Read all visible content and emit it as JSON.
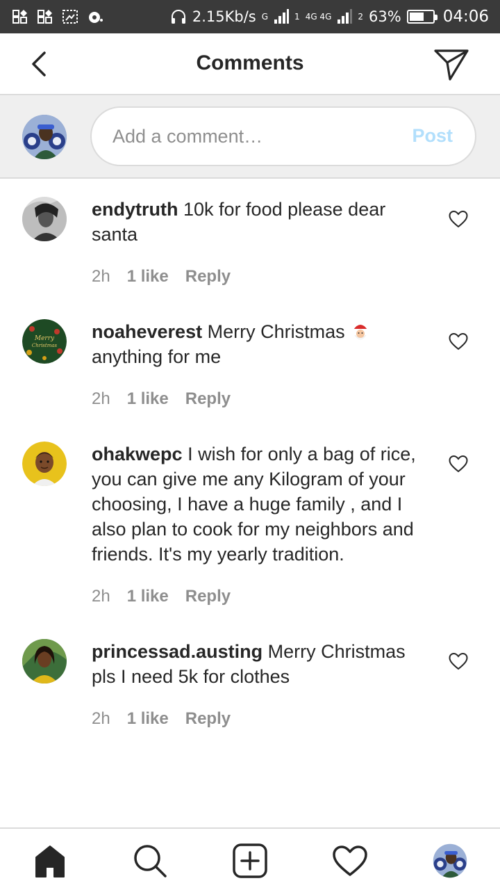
{
  "status_bar": {
    "network_speed": "2.15Kb/s",
    "sim1_label": "G",
    "sim1_slot": "1",
    "sim2_label": "4G 4G",
    "sim2_slot": "2",
    "battery_percent": "63%",
    "battery_level": 0.63,
    "time": "04:06"
  },
  "header": {
    "title": "Comments"
  },
  "composer": {
    "placeholder": "Add a comment…",
    "post_label": "Post",
    "post_color": "#b2dffc"
  },
  "comments": [
    {
      "username": "endytruth",
      "text": "10k for food please dear santa",
      "time": "2h",
      "likes": "1 like",
      "reply": "Reply"
    },
    {
      "username": "noaheverest",
      "text": "Merry Christmas",
      "text_after": "anything for me",
      "emoji": "santa-emoji",
      "time": "2h",
      "likes": "1 like",
      "reply": "Reply",
      "avatar_text": "Merry Christmas"
    },
    {
      "username": "ohakwepc",
      "text": "I wish for only a bag of rice, you can give me any Kilogram of your choosing, I have a huge family , and I also plan to cook for my neighbors and friends. It's my yearly tradition.",
      "time": "2h",
      "likes": "1 like",
      "reply": "Reply"
    },
    {
      "username": "princessad.austing",
      "text": "Merry Christmas pls I need 5k for clothes",
      "time": "2h",
      "likes": "1 like",
      "reply": "Reply"
    }
  ],
  "bottom_nav": {
    "items": [
      "home-icon",
      "search-icon",
      "add-post-icon",
      "activity-heart-icon",
      "profile-avatar"
    ]
  },
  "colors": {
    "text": "#262626",
    "secondary_text": "#8e8e8e",
    "divider": "#dbdbdb",
    "composer_bg": "#efefef",
    "status_bar_bg": "#3a3a3a"
  }
}
